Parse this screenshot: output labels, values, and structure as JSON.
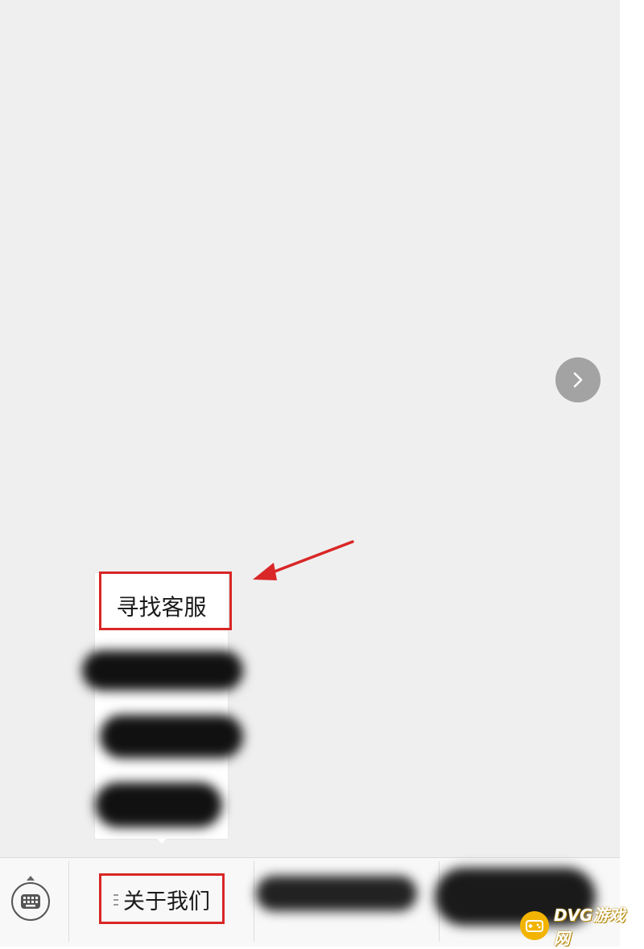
{
  "chat": {
    "next_icon": "chevron-right-icon"
  },
  "submenu": {
    "items": [
      {
        "label": "寻找客服",
        "highlighted": true
      },
      {
        "label": "",
        "redacted": true
      },
      {
        "label": "",
        "redacted": true
      },
      {
        "label": "",
        "redacted": true
      }
    ]
  },
  "bottom_bar": {
    "keyboard_icon": "keyboard-icon",
    "tabs": [
      {
        "label": "关于我们",
        "highlighted": true
      },
      {
        "label": "",
        "redacted": true
      },
      {
        "label": "",
        "redacted": true
      }
    ]
  },
  "annotation": {
    "color": "#d92626"
  },
  "watermark": {
    "text": "DVG游戏网",
    "color": "#f2b400"
  }
}
